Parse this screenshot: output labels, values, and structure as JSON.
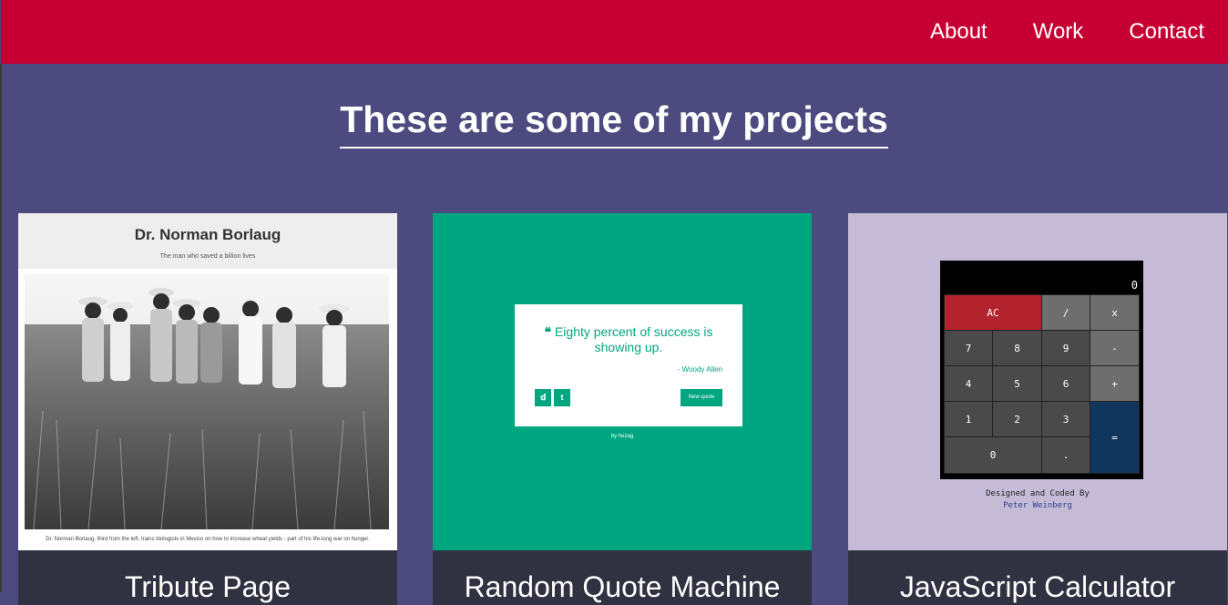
{
  "nav": {
    "items": [
      "About",
      "Work",
      "Contact"
    ]
  },
  "heading": "These are some of my projects",
  "projects": [
    {
      "caption": "Tribute Page",
      "preview": {
        "title": "Dr. Norman Borlaug",
        "subtitle": "The man who saved a billion lives",
        "photo_caption": "Dr. Norman Borlaug, third from the left, trains biologists in Mexico on how to increase wheat yields - part of his life-long war on hunger."
      }
    },
    {
      "caption": "Random Quote Machine",
      "preview": {
        "quote": "Eighty percent of success is showing up.",
        "author": "- Woody Allen",
        "new_quote": "New quote",
        "byline": "by hezag"
      }
    },
    {
      "caption": "JavaScript Calculator",
      "preview": {
        "display": "0",
        "keys": [
          "AC",
          "/",
          "x",
          "7",
          "8",
          "9",
          "-",
          "4",
          "5",
          "6",
          "+",
          "1",
          "2",
          "3",
          "=",
          "0",
          "."
        ],
        "credit_line": "Designed and Coded By",
        "credit_name": "Peter Weinberg"
      }
    }
  ],
  "colors": {
    "nav": "#c70033",
    "page": "#4c4a7e",
    "caption": "#303241",
    "quote": "#00a680",
    "calc_bg": "#c5bbd7"
  }
}
